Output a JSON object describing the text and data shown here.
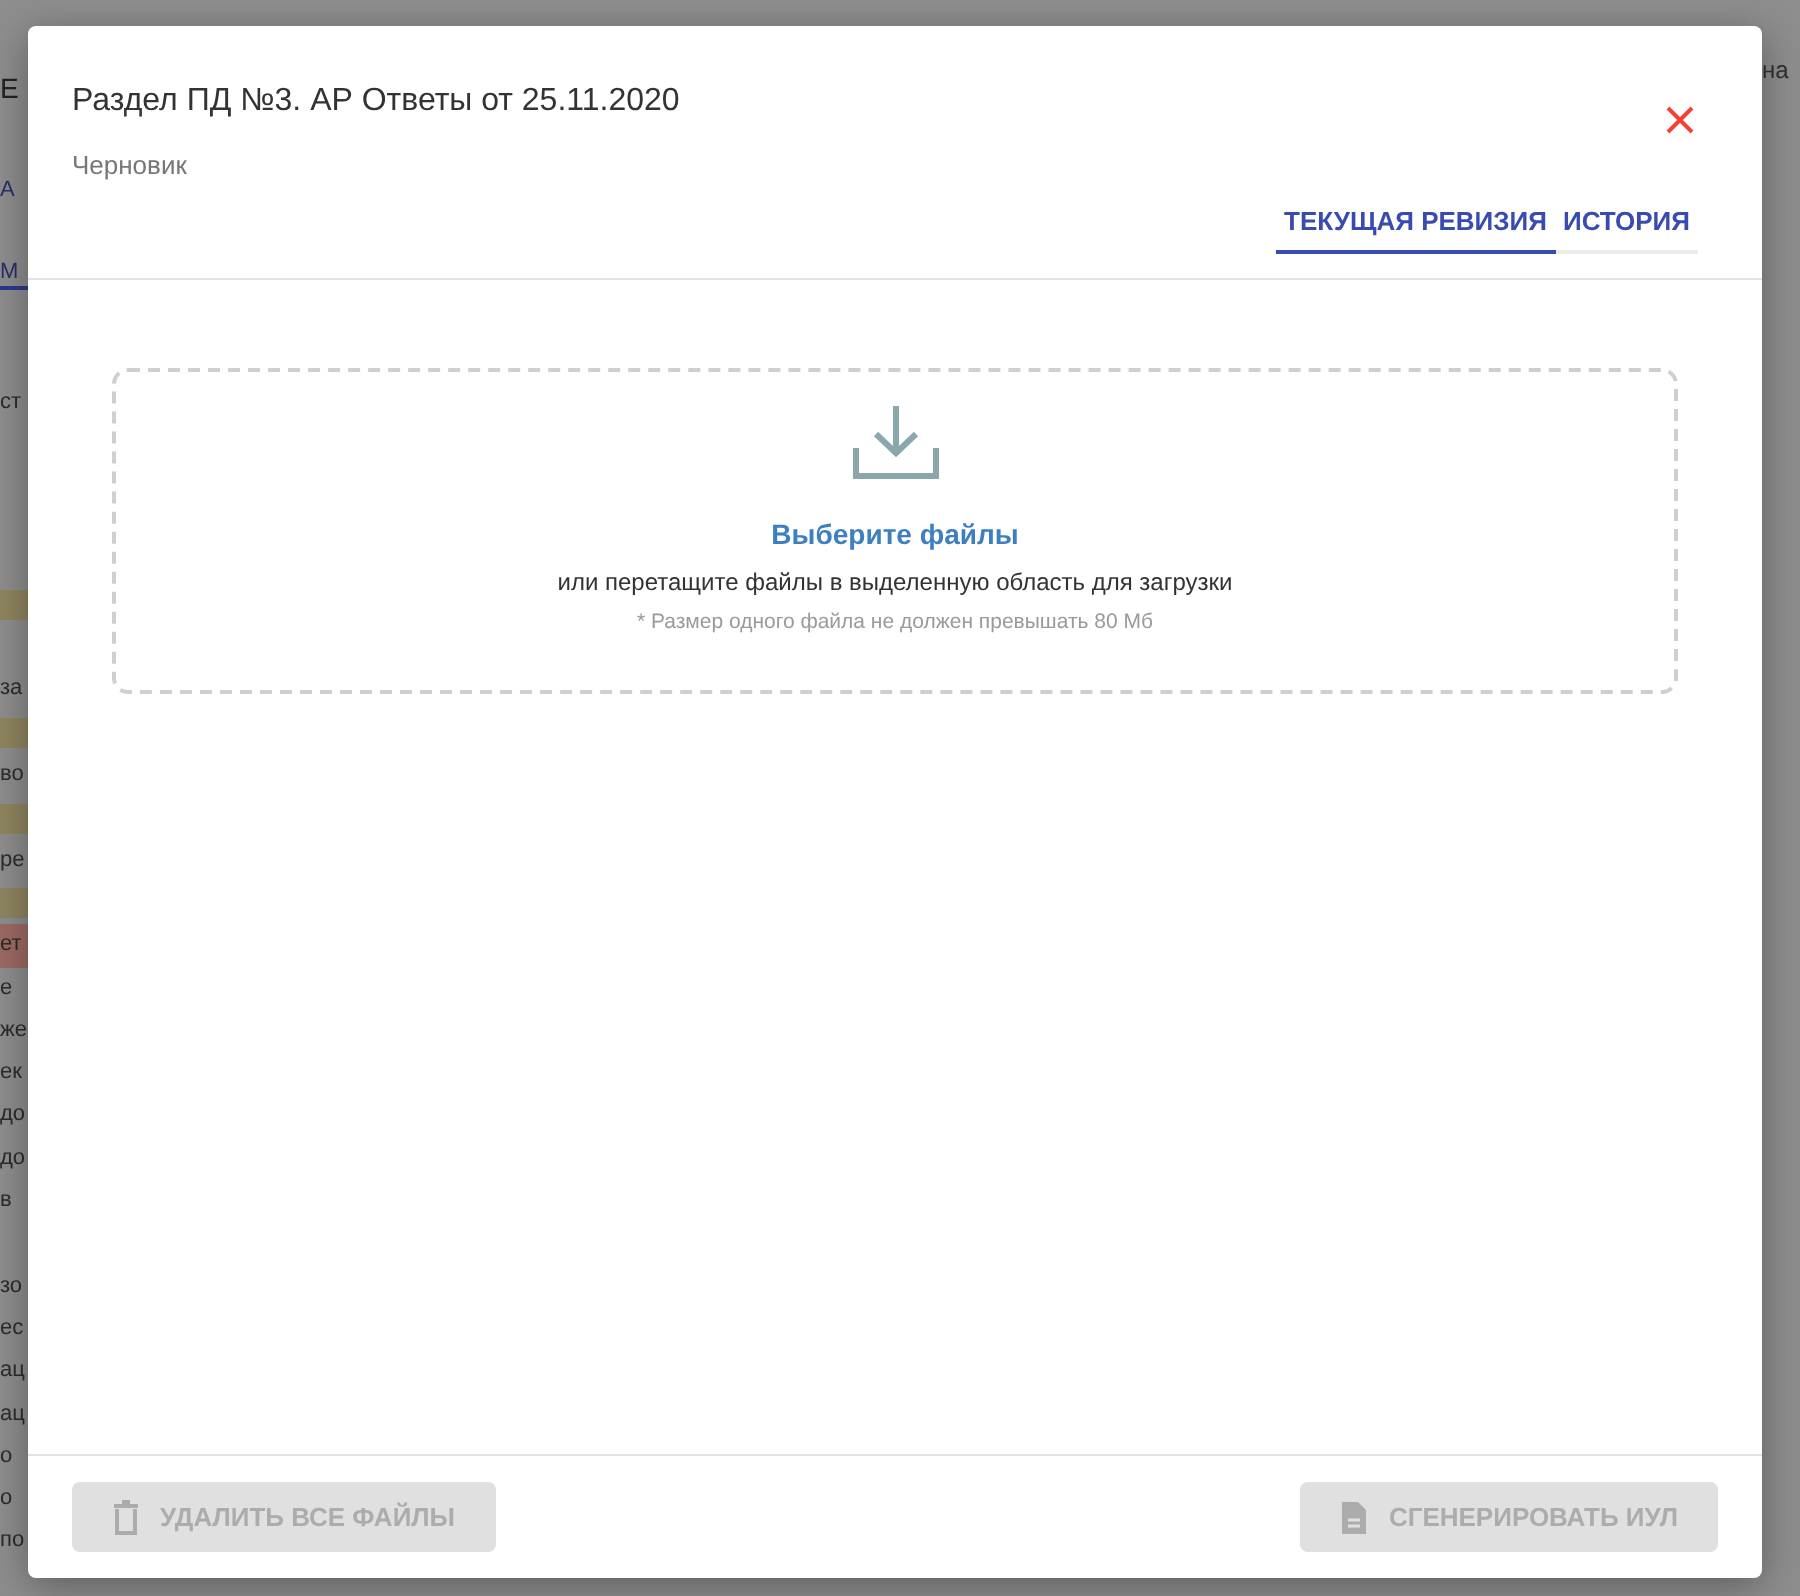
{
  "background": {
    "left_fragments": [
      {
        "kind": "heading",
        "text": "Е"
      },
      {
        "kind": "link",
        "text": "А"
      },
      {
        "kind": "tab",
        "text": "М"
      },
      {
        "kind": "text",
        "text": "ст"
      },
      {
        "kind": "highlight",
        "color": "#8f8660"
      },
      {
        "kind": "blank"
      },
      {
        "kind": "text",
        "text": "за"
      },
      {
        "kind": "highlight",
        "color": "#8f8660"
      },
      {
        "kind": "text",
        "text": "во"
      },
      {
        "kind": "highlight",
        "color": "#8f8660"
      },
      {
        "kind": "text",
        "text": "ре"
      },
      {
        "kind": "highlight",
        "color": "#8f8660"
      },
      {
        "kind": "highlight",
        "color": "#9e6a64",
        "text": "ет"
      },
      {
        "kind": "text",
        "text": "е"
      },
      {
        "kind": "text",
        "text": "же"
      },
      {
        "kind": "text",
        "text": "ек"
      },
      {
        "kind": "text",
        "text": "до"
      },
      {
        "kind": "text",
        "text": "до"
      },
      {
        "kind": "text",
        "text": "в"
      },
      {
        "kind": "blank"
      },
      {
        "kind": "text",
        "text": "зо"
      },
      {
        "kind": "text",
        "text": "ес"
      },
      {
        "kind": "text",
        "text": "ац"
      },
      {
        "kind": "text",
        "text": "ац"
      },
      {
        "kind": "text",
        "text": "о"
      },
      {
        "kind": "text",
        "text": "о"
      },
      {
        "kind": "text",
        "text": "по"
      }
    ],
    "right_fragments": [
      "на"
    ]
  },
  "dialog": {
    "title": "Раздел ПД №3. АР Ответы от 25.11.2020",
    "subtitle": "Черновик",
    "tabs": [
      {
        "label": "ТЕКУЩАЯ РЕВИЗИЯ",
        "selected": true
      },
      {
        "label": "ИСТОРИЯ",
        "selected": false
      }
    ],
    "dropzone": {
      "link": "Выберите файлы",
      "hint": "или перетащите файлы в выделенную область для загрузки",
      "note": "* Размер одного файла не должен превышать 80 Мб"
    },
    "buttons": [
      {
        "kind": "delete",
        "label": "УДАЛИТЬ ВСЕ ФАЙЛЫ",
        "disabled": true
      },
      {
        "kind": "generate",
        "label": "СГЕНЕРИРОВАТЬ ИУЛ",
        "disabled": true
      }
    ]
  }
}
